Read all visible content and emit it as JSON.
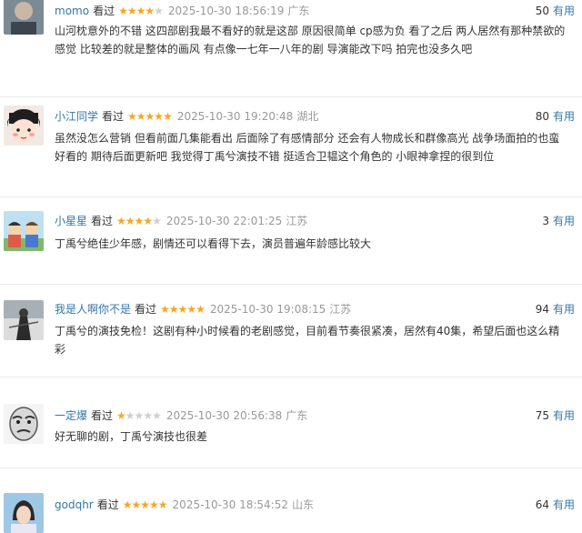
{
  "watched_label": "看过",
  "useful_label": "有用",
  "reviews": [
    {
      "user": "momo",
      "rating": 4,
      "time": "2025-10-30 18:56:19",
      "location": "广东",
      "votes": "50",
      "text": "山河枕意外的不错 这四部剧我最不看好的就是这部 原因很简单 cp感为负 看了之后 两人居然有那种禁欲的感觉 比较差的就是整体的画风 有点像一七年一八年的剧 导演能改下吗 拍完也没多久吧"
    },
    {
      "user": "小江同学",
      "rating": 5,
      "time": "2025-10-30 19:20:48",
      "location": "湖北",
      "votes": "80",
      "text": "虽然没怎么营销 但看前面几集能看出 后面除了有感情部分 还会有人物成长和群像高光 战争场面拍的也蛮好看的 期待后面更新吧 我觉得丁禹兮演技不错 挺适合卫韫这个角色的 小眼神拿捏的很到位"
    },
    {
      "user": "小星星",
      "rating": 4,
      "time": "2025-10-30 22:01:25",
      "location": "江苏",
      "votes": "3",
      "text": "丁禹兮绝佳少年感，剧情还可以看得下去，演员普遍年龄感比较大"
    },
    {
      "user": "我是人啊你不是",
      "rating": 5,
      "time": "2025-10-30 19:08:15",
      "location": "江苏",
      "votes": "94",
      "text": "丁禹兮的演技免检！这剧有种小时候看的老剧感觉，目前看节奏很紧凑，居然有40集，希望后面也这么精彩"
    },
    {
      "user": "一定爆",
      "rating": 1,
      "time": "2025-10-30 20:56:38",
      "location": "广东",
      "votes": "75",
      "text": "好无聊的剧，丁禹兮演技也很差"
    },
    {
      "user": "godqhr",
      "rating": 5,
      "time": "2025-10-30 18:54:52",
      "location": "山东",
      "votes": "64",
      "text": ""
    }
  ]
}
